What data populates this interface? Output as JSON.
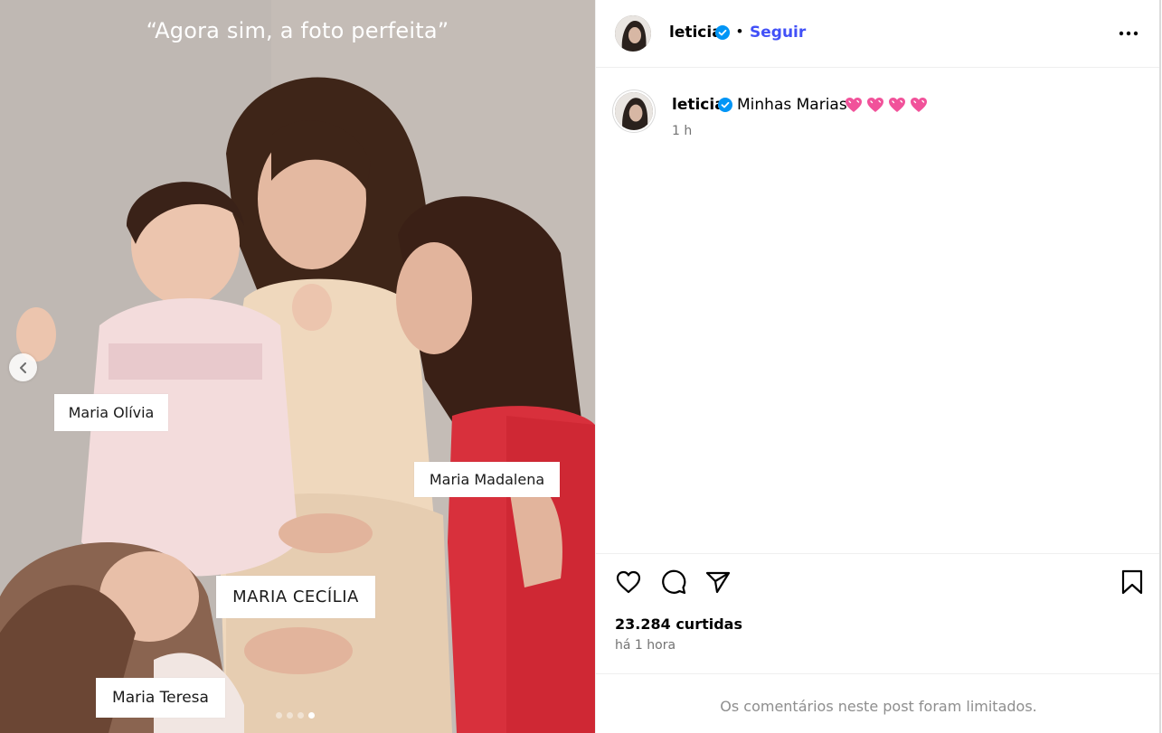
{
  "media": {
    "quote": "“Agora sim, a foto perfeita”",
    "tags": {
      "olivia": "Maria Olívia",
      "madalena": "Maria Madalena",
      "cecilia": "MARIA CECÍLIA",
      "teresa": "Maria Teresa"
    },
    "carousel": {
      "count": 4,
      "active_index": 4
    }
  },
  "post": {
    "username": "leticia",
    "verified": true,
    "follow_label": "Seguir",
    "caption": {
      "username": "leticia",
      "text": "Minhas Marias",
      "emoji": "💗 💗 💗 💗",
      "time": "1 h"
    },
    "likes": "23.284 curtidas",
    "posted_ago": "há 1 hora",
    "comments_notice": "Os comentários neste post foram limitados."
  },
  "colors": {
    "follow": "#4150f7",
    "verified": "#0095f6",
    "secondary_text": "#737373",
    "dress_red": "#d8303c",
    "heart_pink": "#f1529a"
  },
  "icons": [
    "chevron-left-icon",
    "more-icon",
    "verified-icon",
    "heart-icon",
    "comment-icon",
    "share-icon",
    "bookmark-icon"
  ]
}
